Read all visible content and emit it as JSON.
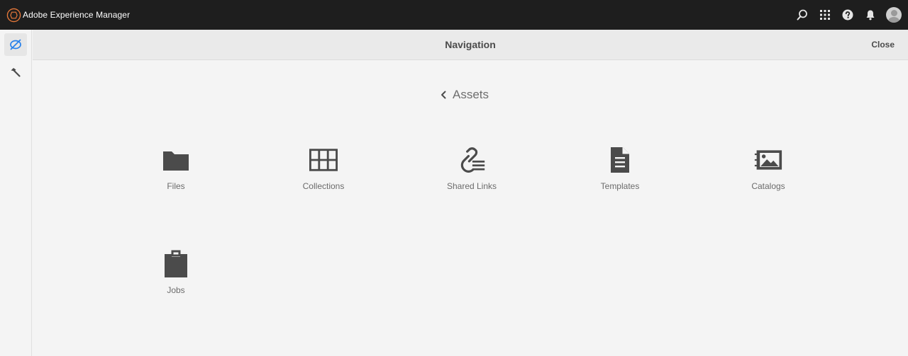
{
  "app": {
    "brand_name": "Adobe Experience Manager"
  },
  "topbar": {
    "icons": [
      "search-icon",
      "app-grid-icon",
      "help-icon",
      "bell-icon",
      "user-avatar"
    ]
  },
  "rail": {
    "items": [
      {
        "icon": "navigation-compass-icon",
        "active": true
      },
      {
        "icon": "hammer-tools-icon",
        "active": false
      }
    ]
  },
  "panel": {
    "title": "Navigation",
    "close_label": "Close"
  },
  "breadcrumb": {
    "icon": "chevron-left-icon",
    "label": "Assets"
  },
  "tiles": [
    {
      "label": "Files",
      "icon": "folder-icon"
    },
    {
      "label": "Collections",
      "icon": "collections-grid-icon"
    },
    {
      "label": "Shared Links",
      "icon": "shared-links-icon"
    },
    {
      "label": "Templates",
      "icon": "template-document-icon"
    },
    {
      "label": "Catalogs",
      "icon": "catalog-image-icon"
    },
    {
      "label": "Jobs",
      "icon": "clipboard-jobs-icon"
    }
  ],
  "colors": {
    "topbar_bg": "#1e1e1e",
    "page_bg": "#f4f4f4",
    "icon_gray": "#4b4b4b",
    "rail_active_icon": "#2680eb",
    "brand_logo": "#e8793a"
  }
}
